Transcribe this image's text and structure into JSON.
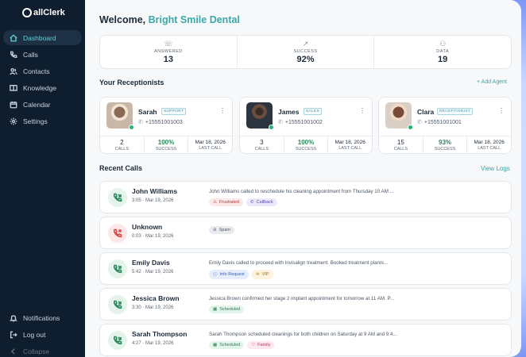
{
  "app": {
    "logo_text": "allClerk"
  },
  "sidebar": {
    "items": [
      {
        "label": "Dashboard",
        "icon": "home-icon",
        "active": true
      },
      {
        "label": "Calls",
        "icon": "phone-icon"
      },
      {
        "label": "Contacts",
        "icon": "users-icon"
      },
      {
        "label": "Knowledge",
        "icon": "book-icon"
      },
      {
        "label": "Calendar",
        "icon": "calendar-icon"
      },
      {
        "label": "Settings",
        "icon": "gear-icon"
      }
    ],
    "bottom": [
      {
        "label": "Notifications",
        "icon": "bell-icon"
      },
      {
        "label": "Log out",
        "icon": "logout-icon"
      },
      {
        "label": "Collapse",
        "icon": "collapse-icon"
      }
    ]
  },
  "header": {
    "welcome": "Welcome, ",
    "business": "Bright Smile Dental"
  },
  "stats": [
    {
      "label": "ANSWERED",
      "value": "13",
      "icon": "phone-incoming-icon"
    },
    {
      "label": "SUCCESS",
      "value": "92%",
      "icon": "trend-up-icon"
    },
    {
      "label": "DATA",
      "value": "19",
      "icon": "users-icon"
    }
  ],
  "receptionists": {
    "title": "Your Receptionists",
    "add_label": "+ Add Agent",
    "agents": [
      {
        "name": "Sarah",
        "role": "SUPPORT",
        "phone": "+15551001003",
        "calls": "2",
        "success": "100%",
        "last_call": "Mar 18, 2026",
        "photo_color": "#8a6a55",
        "bg": "#c9b8a8"
      },
      {
        "name": "James",
        "role": "SALES",
        "phone": "+15551001002",
        "calls": "3",
        "success": "100%",
        "last_call": "Mar 18, 2026",
        "photo_color": "#3a2d28",
        "bg": "#4f5a66"
      },
      {
        "name": "Clara",
        "role": "RECEPTIONIST",
        "phone": "+15551001001",
        "calls": "15",
        "success": "93%",
        "last_call": "Mar 18, 2026",
        "photo_color": "#7a4a38",
        "bg": "#d9cfc4"
      }
    ],
    "metric_labels": {
      "calls": "CALLS",
      "success": "SUCCESS",
      "last_call": "LAST CALL"
    }
  },
  "recent": {
    "title": "Recent Calls",
    "view_logs": "View Logs",
    "calls": [
      {
        "name": "John Williams",
        "duration": "3:05",
        "date": "Mar 19, 2026",
        "status": "ok",
        "summary": "John Williams called to reschedule his cleaning appointment from Thursday 10 AM ...",
        "tags": [
          {
            "label": "Frustrated",
            "type": "frustrated"
          },
          {
            "label": "Callback",
            "type": "callback"
          }
        ]
      },
      {
        "name": "Unknown",
        "duration": "0:03",
        "date": "Mar 19, 2026",
        "status": "bad",
        "summary": "",
        "tags": [
          {
            "label": "Spam",
            "type": "spam"
          }
        ]
      },
      {
        "name": "Emily Davis",
        "duration": "5:42",
        "date": "Mar 19, 2026",
        "status": "ok",
        "summary": "Emily Davis called to proceed with Invisalign treatment. Booked treatment planni...",
        "tags": [
          {
            "label": "Info Request",
            "type": "info"
          },
          {
            "label": "VIP",
            "type": "vip"
          }
        ]
      },
      {
        "name": "Jessica Brown",
        "duration": "3:30",
        "date": "Mar 19, 2026",
        "status": "ok",
        "summary": "Jessica Brown confirmed her stage 2 implant appointment for tomorrow at 11 AM. P...",
        "tags": [
          {
            "label": "Scheduled",
            "type": "scheduled"
          }
        ]
      },
      {
        "name": "Sarah Thompson",
        "duration": "4:27",
        "date": "Mar 19, 2026",
        "status": "ok",
        "summary": "Sarah Thompson scheduled cleanings for both children on Saturday at 9 AM and 9:4...",
        "tags": [
          {
            "label": "Scheduled",
            "type": "scheduled"
          },
          {
            "label": "Family",
            "type": "family"
          }
        ]
      }
    ]
  }
}
